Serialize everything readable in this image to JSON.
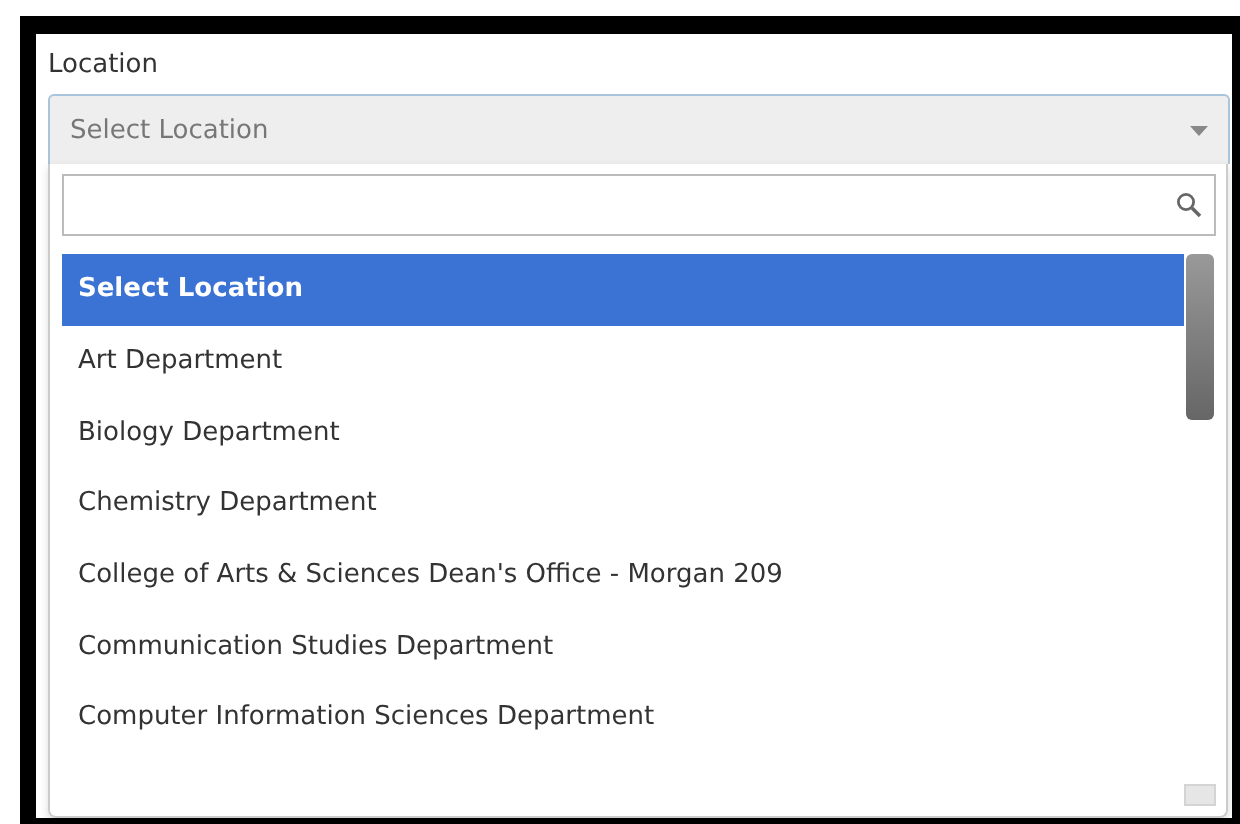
{
  "field": {
    "label": "Location",
    "value": "Select Location"
  },
  "options": [
    {
      "label": "Select Location",
      "selected": true
    },
    {
      "label": "Art Department",
      "selected": false
    },
    {
      "label": "Biology Department",
      "selected": false
    },
    {
      "label": "Chemistry Department",
      "selected": false
    },
    {
      "label": "College of Arts & Sciences Dean's Office - Morgan 209",
      "selected": false
    },
    {
      "label": "Communication Studies Department",
      "selected": false
    },
    {
      "label": "Computer Information Sciences Department",
      "selected": false
    }
  ]
}
